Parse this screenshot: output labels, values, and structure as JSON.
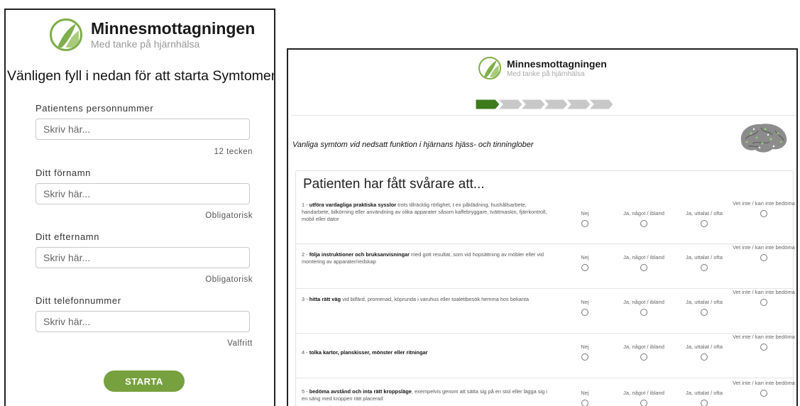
{
  "left_form": {
    "brand": {
      "name": "Minnesmottagningen",
      "tagline": "Med tanke på hjärnhälsa"
    },
    "heading": "Vänligen fyll i nedan för att starta Symtomenkäten",
    "fields": [
      {
        "label": "Patientens personnummer",
        "placeholder": "Skriv här...",
        "hint": "12 tecken"
      },
      {
        "label": "Ditt förnamn",
        "placeholder": "Skriv här...",
        "hint": "Obligatorisk"
      },
      {
        "label": "Ditt efternamn",
        "placeholder": "Skriv här...",
        "hint": "Obligatorisk"
      },
      {
        "label": "Ditt telefonnummer",
        "placeholder": "Skriv här...",
        "hint": "Valfritt"
      }
    ],
    "start_label": "STARTA"
  },
  "right_form": {
    "brand": {
      "name": "Minnesmottagningen",
      "tagline": "Med tanke på hjärnhälsa"
    },
    "progress": {
      "total_steps": 6,
      "current_step": 1
    },
    "section_title": "Vanliga symtom vid nedsatt funktion i hjärnans hjäss- och tinninglober",
    "card_title": "Patienten har fått svårare att...",
    "options": [
      "Nej",
      "Ja, något / ibland",
      "Ja, uttalat / ofta",
      "Vet inte / kan inte bedöma"
    ],
    "questions": [
      {
        "num": "1 - ",
        "bold": "utföra vardagliga praktiska sysslor",
        "rest": " trots tillräcklig rörlighet, t ex påklädning, hushållsarbete, handarbete, bilkörning eller användning av olika apparater såsom kaffebryggare, tvättmaskin, fjärrkontroll, mobil eller dator"
      },
      {
        "num": "2 - ",
        "bold": "följa instruktioner och bruksanvisningar",
        "rest": " med gott resultat, som vid hopsättning av möbler eller vid montering av apparater/redskap"
      },
      {
        "num": "3 - ",
        "bold": "hitta rätt väg",
        "rest": " vid bilfärd, promenad, köprunda i varuhus eller toalettbesök hemma hos bekanta"
      },
      {
        "num": "4 - ",
        "bold": "tolka kartor, planskisser, mönster eller ritningar",
        "rest": ""
      },
      {
        "num": "5 - ",
        "bold": "bedöma avstånd och inta rätt kroppsläge",
        "rest": ", exempelvis genom att sätta sig på en stol eller lägga sig i en säng med kroppen rätt placerad"
      }
    ],
    "colors": {
      "accent": "#77a13e",
      "progress_done": "#3d7a1a",
      "progress_todo": "#c8c8c8"
    }
  }
}
